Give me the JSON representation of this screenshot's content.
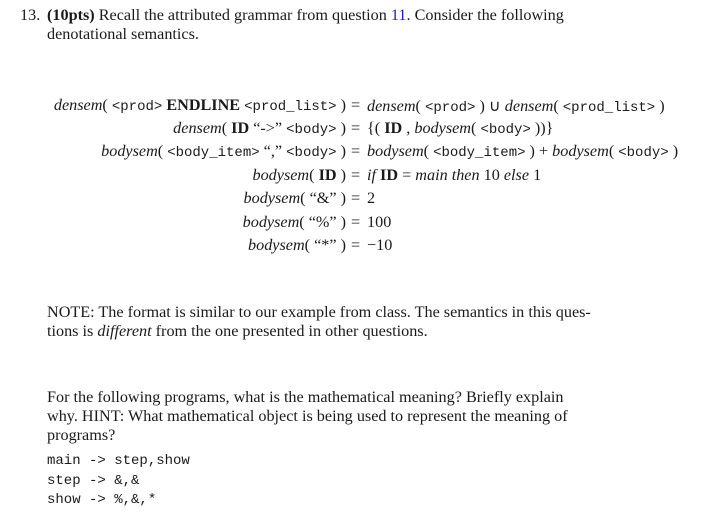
{
  "question": {
    "number": "13.",
    "points": "(10pts)",
    "intro_before_ref": " Recall the attributed grammar from question ",
    "ref": "11",
    "intro_after_ref": ".  Consider the following",
    "intro_line2": "denotational semantics.",
    "ref_color": "#1a1acc"
  },
  "equations": [
    {
      "lhs": [
        {
          "t": "densem",
          "s": "fn"
        },
        {
          "t": "( ",
          "s": ""
        },
        {
          "t": "<prod>",
          "s": "tt"
        },
        {
          "t": " ENDLINE ",
          "s": "kw"
        },
        {
          "t": "<prod_list>",
          "s": "tt"
        },
        {
          "t": " )",
          "s": ""
        }
      ],
      "rhs": [
        {
          "t": "densem",
          "s": "fn"
        },
        {
          "t": "( ",
          "s": ""
        },
        {
          "t": "<prod>",
          "s": "tt"
        },
        {
          "t": " ) ∪ ",
          "s": ""
        },
        {
          "t": "densem",
          "s": "fn"
        },
        {
          "t": "( ",
          "s": ""
        },
        {
          "t": "<prod_list>",
          "s": "tt"
        },
        {
          "t": " )",
          "s": ""
        }
      ]
    },
    {
      "lhs": [
        {
          "t": "densem",
          "s": "fn"
        },
        {
          "t": "( ",
          "s": ""
        },
        {
          "t": "ID",
          "s": "kw"
        },
        {
          "t": " “->” ",
          "s": ""
        },
        {
          "t": "<body>",
          "s": "tt"
        },
        {
          "t": " )",
          "s": ""
        }
      ],
      "rhs": [
        {
          "t": "{( ",
          "s": ""
        },
        {
          "t": "ID",
          "s": "kw"
        },
        {
          "t": " , ",
          "s": ""
        },
        {
          "t": "bodysem",
          "s": "fn"
        },
        {
          "t": "( ",
          "s": ""
        },
        {
          "t": "<body>",
          "s": "tt"
        },
        {
          "t": " ))}",
          "s": ""
        }
      ]
    },
    {
      "lhs": [
        {
          "t": "bodysem",
          "s": "fn"
        },
        {
          "t": "( ",
          "s": ""
        },
        {
          "t": "<body_item>",
          "s": "tt"
        },
        {
          "t": " “,” ",
          "s": ""
        },
        {
          "t": "<body>",
          "s": "tt"
        },
        {
          "t": " )",
          "s": ""
        }
      ],
      "rhs": [
        {
          "t": "bodysem",
          "s": "fn"
        },
        {
          "t": "( ",
          "s": ""
        },
        {
          "t": "<body_item>",
          "s": "tt"
        },
        {
          "t": " ) + ",
          "s": ""
        },
        {
          "t": "bodysem",
          "s": "fn"
        },
        {
          "t": "( ",
          "s": ""
        },
        {
          "t": "<body>",
          "s": "tt"
        },
        {
          "t": " )",
          "s": ""
        }
      ]
    },
    {
      "lhs": [
        {
          "t": "bodysem",
          "s": "fn"
        },
        {
          "t": "( ",
          "s": ""
        },
        {
          "t": "ID",
          "s": "kw"
        },
        {
          "t": " )",
          "s": ""
        }
      ],
      "rhs": [
        {
          "t": "if ",
          "s": "mi"
        },
        {
          "t": "ID",
          "s": "kw"
        },
        {
          "t": " = ",
          "s": ""
        },
        {
          "t": "main",
          "s": "mi"
        },
        {
          "t": "  ",
          "s": ""
        },
        {
          "t": "then",
          "s": "mi"
        },
        {
          "t": "  10  ",
          "s": ""
        },
        {
          "t": "else",
          "s": "mi"
        },
        {
          "t": "  1",
          "s": ""
        }
      ]
    },
    {
      "lhs": [
        {
          "t": "bodysem",
          "s": "fn"
        },
        {
          "t": "( “&” )",
          "s": ""
        }
      ],
      "rhs": [
        {
          "t": "2",
          "s": ""
        }
      ]
    },
    {
      "lhs": [
        {
          "t": "bodysem",
          "s": "fn"
        },
        {
          "t": "( “%” )",
          "s": ""
        }
      ],
      "rhs": [
        {
          "t": "100",
          "s": ""
        }
      ]
    },
    {
      "lhs": [
        {
          "t": "bodysem",
          "s": "fn"
        },
        {
          "t": "( “*” )",
          "s": ""
        }
      ],
      "rhs": [
        {
          "t": "−10",
          "s": ""
        }
      ]
    }
  ],
  "equals_sign": "=",
  "note": {
    "line1": "NOTE: The format is similar to our example from class.  The semantics in this ques-",
    "line2_before": "tions is ",
    "line2_emph": "different",
    "line2_after": " from the one presented in other questions."
  },
  "instructions": {
    "line1": "For the following programs, what is the mathematical meaning?  Briefly explain",
    "line2": "why.  HINT: What mathematical object is being used to represent the meaning of",
    "line3": "programs?"
  },
  "program": {
    "lines": [
      "main -> step,show",
      "step -> &,&",
      "show -> %,&,*"
    ]
  }
}
